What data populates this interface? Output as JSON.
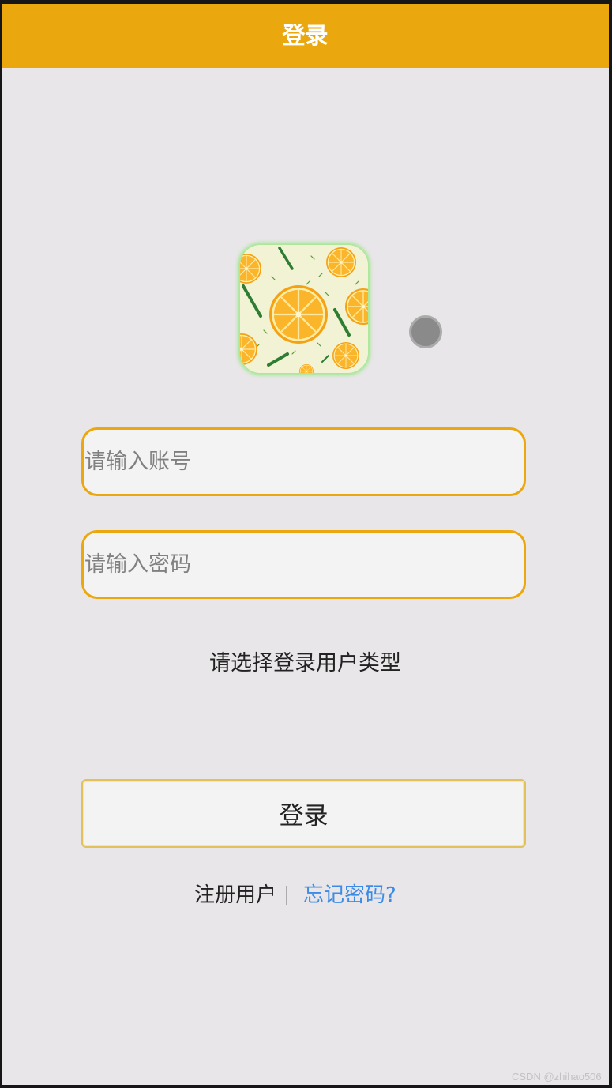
{
  "header": {
    "title": "登录"
  },
  "icons": {
    "logo": "orange-slices-logo",
    "status_dot": "gray-dot-icon"
  },
  "form": {
    "account": {
      "placeholder": "请输入账号",
      "value": ""
    },
    "password": {
      "placeholder": "请输入密码",
      "value": ""
    },
    "user_type": {
      "label": "请选择登录用户类型"
    },
    "submit_label": "登录"
  },
  "links": {
    "register": "注册用户",
    "forgot_password": "忘记密码?"
  },
  "watermark": "CSDN @zhihao506",
  "colors": {
    "accent": "#EBA70E",
    "background": "#E8E6E8",
    "input_background": "#F3F3F3",
    "link": "#3C8CE7",
    "button_border": "#E2C15A"
  }
}
